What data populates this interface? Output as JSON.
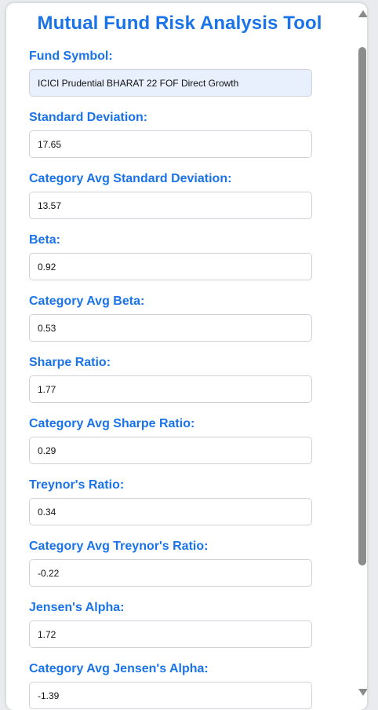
{
  "title": "Mutual Fund Risk Analysis Tool",
  "fields": [
    {
      "label": "Fund Symbol:",
      "value": "ICICI Prudential BHARAT 22 FOF Direct Growth"
    },
    {
      "label": "Standard Deviation:",
      "value": "17.65"
    },
    {
      "label": "Category Avg Standard Deviation:",
      "value": "13.57"
    },
    {
      "label": "Beta:",
      "value": "0.92"
    },
    {
      "label": "Category Avg Beta:",
      "value": "0.53"
    },
    {
      "label": "Sharpe Ratio:",
      "value": "1.77"
    },
    {
      "label": "Category Avg Sharpe Ratio:",
      "value": "0.29"
    },
    {
      "label": "Treynor's Ratio:",
      "value": "0.34"
    },
    {
      "label": "Category Avg Treynor's Ratio:",
      "value": "-0.22"
    },
    {
      "label": "Jensen's Alpha:",
      "value": "1.72"
    },
    {
      "label": "Category Avg Jensen's Alpha:",
      "value": "-1.39"
    }
  ],
  "colors": {
    "accent": "#1a73e8",
    "highlight_field": "#e8f0fe"
  }
}
